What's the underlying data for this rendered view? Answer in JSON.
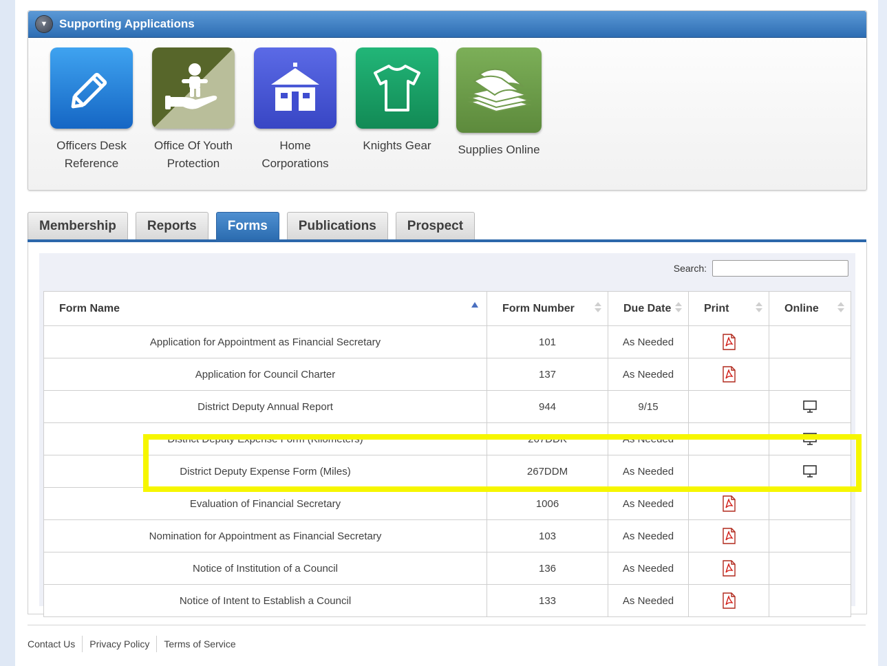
{
  "panel": {
    "title": "Supporting Applications",
    "apps": [
      {
        "label": "Officers Desk Reference",
        "icon": "pencil-icon",
        "color": "#1e7fd8"
      },
      {
        "label": "Office Of Youth Protection",
        "icon": "youth-protection-icon",
        "color": "#6f7c3a"
      },
      {
        "label": "Home Corporations",
        "icon": "house-icon",
        "color": "#4a58d6"
      },
      {
        "label": "Knights Gear",
        "icon": "tshirt-icon",
        "color": "#1ea06a"
      },
      {
        "label": "Supplies Online",
        "icon": "paper-stack-icon",
        "color": "#6f9a4c"
      }
    ]
  },
  "tabs": [
    {
      "label": "Membership",
      "active": false
    },
    {
      "label": "Reports",
      "active": false
    },
    {
      "label": "Forms",
      "active": true
    },
    {
      "label": "Publications",
      "active": false
    },
    {
      "label": "Prospect",
      "active": false
    }
  ],
  "search": {
    "label": "Search:",
    "value": ""
  },
  "table": {
    "columns": [
      "Form Name",
      "Form Number",
      "Due Date",
      "Print",
      "Online"
    ],
    "rows": [
      {
        "name": "Application for Appointment as Financial Secretary",
        "number": "101",
        "due": "As Needed",
        "print": true,
        "online": false
      },
      {
        "name": "Application for Council Charter",
        "number": "137",
        "due": "As Needed",
        "print": true,
        "online": false
      },
      {
        "name": "District Deputy Annual Report",
        "number": "944",
        "due": "9/15",
        "print": false,
        "online": true
      },
      {
        "name": "District Deputy Expense Form (Kilometers)",
        "number": "267DDK",
        "due": "As Needed",
        "print": false,
        "online": true
      },
      {
        "name": "District Deputy Expense Form (Miles)",
        "number": "267DDM",
        "due": "As Needed",
        "print": false,
        "online": true
      },
      {
        "name": "Evaluation of Financial Secretary",
        "number": "1006",
        "due": "As Needed",
        "print": true,
        "online": false
      },
      {
        "name": "Nomination for Appointment as Financial Secretary",
        "number": "103",
        "due": "As Needed",
        "print": true,
        "online": false
      },
      {
        "name": "Notice of Institution of a Council",
        "number": "136",
        "due": "As Needed",
        "print": true,
        "online": false
      },
      {
        "name": "Notice of Intent to Establish a Council",
        "number": "133",
        "due": "As Needed",
        "print": true,
        "online": false
      }
    ]
  },
  "footer": {
    "links": [
      "Contact Us",
      "Privacy Policy",
      "Terms of Service"
    ]
  },
  "highlight_color": "#f6f600"
}
